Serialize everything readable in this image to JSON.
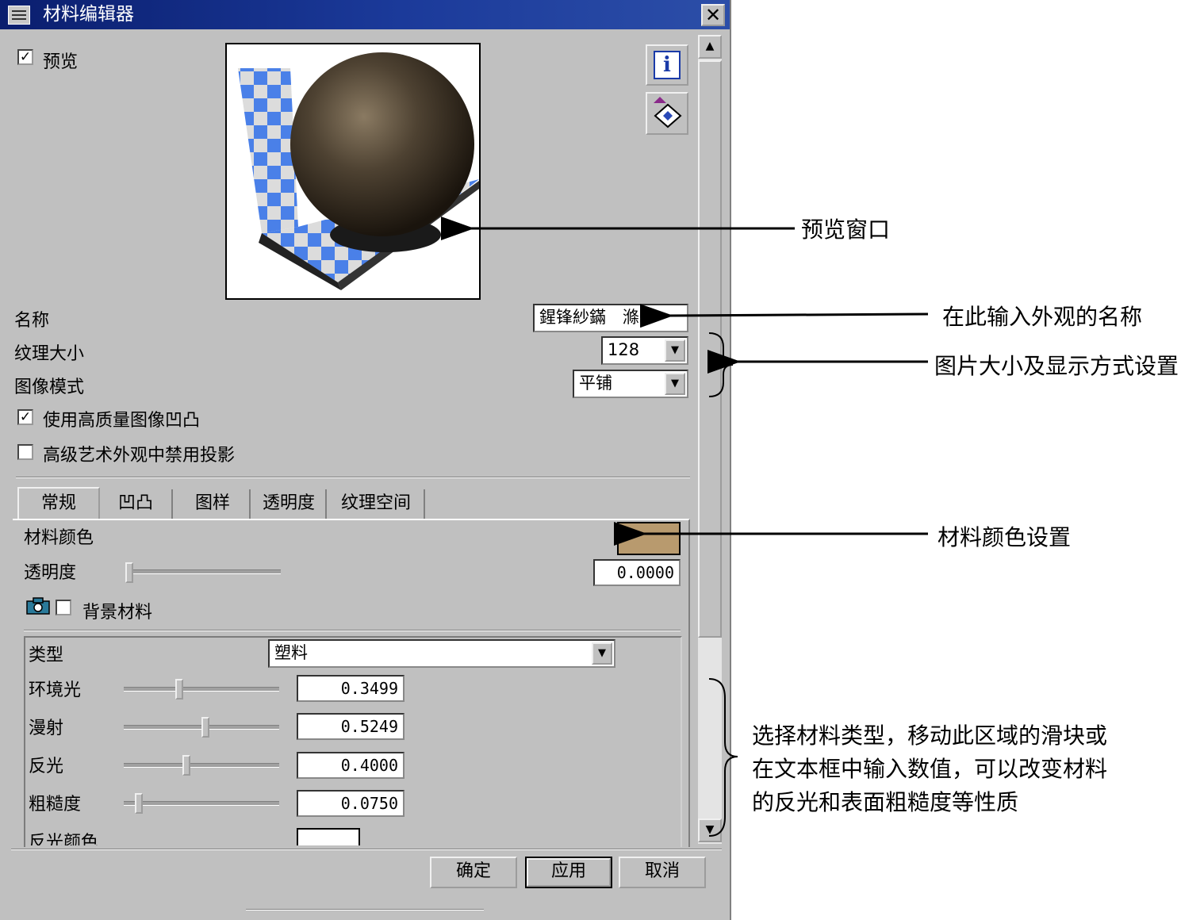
{
  "window": {
    "title": "材料编辑器",
    "close_glyph": "✕"
  },
  "preview": {
    "label": "预览",
    "checked": true
  },
  "icons": {
    "info": "i"
  },
  "name": {
    "label": "名称",
    "value": "鍟锋紗鏋　滌"
  },
  "texture_size": {
    "label": "纹理大小",
    "value": "128"
  },
  "image_mode": {
    "label": "图像模式",
    "value": "平铺"
  },
  "options": {
    "hq_bump": {
      "label": "使用高质量图像凹凸",
      "checked": true
    },
    "disable_shadow": {
      "label": "高级艺术外观中禁用投影",
      "checked": false
    }
  },
  "tabs": [
    "常规",
    "凹凸",
    "图样",
    "透明度",
    "纹理空间"
  ],
  "general": {
    "material_color_label": "材料颜色",
    "material_color": "#b89a6e",
    "transparency_label": "透明度",
    "transparency_value": "0.0000",
    "transparency_level": 0,
    "background_material_label": "背景材料"
  },
  "material": {
    "type_label": "类型",
    "type_value": "塑料",
    "rows": [
      {
        "label": "环境光",
        "value": "0.3499",
        "level": 0.3499
      },
      {
        "label": "漫射",
        "value": "0.5249",
        "level": 0.5249
      },
      {
        "label": "反光",
        "value": "0.4000",
        "level": 0.4
      },
      {
        "label": "粗糙度",
        "value": "0.0750",
        "level": 0.075
      }
    ],
    "reflect_color_label": "反光颜色"
  },
  "buttons": {
    "ok": "确定",
    "apply": "应用",
    "cancel": "取消"
  },
  "annotations": {
    "preview_window": "预览窗口",
    "name_input": "在此输入外观的名称",
    "image_settings": "图片大小及显示方式设置",
    "color_settings": "材料颜色设置",
    "material_line1": "选择材料类型，移动此区域的滑块或",
    "material_line2": "在文本框中输入数值，可以改变材料",
    "material_line3": "的反光和表面粗糙度等性质"
  }
}
